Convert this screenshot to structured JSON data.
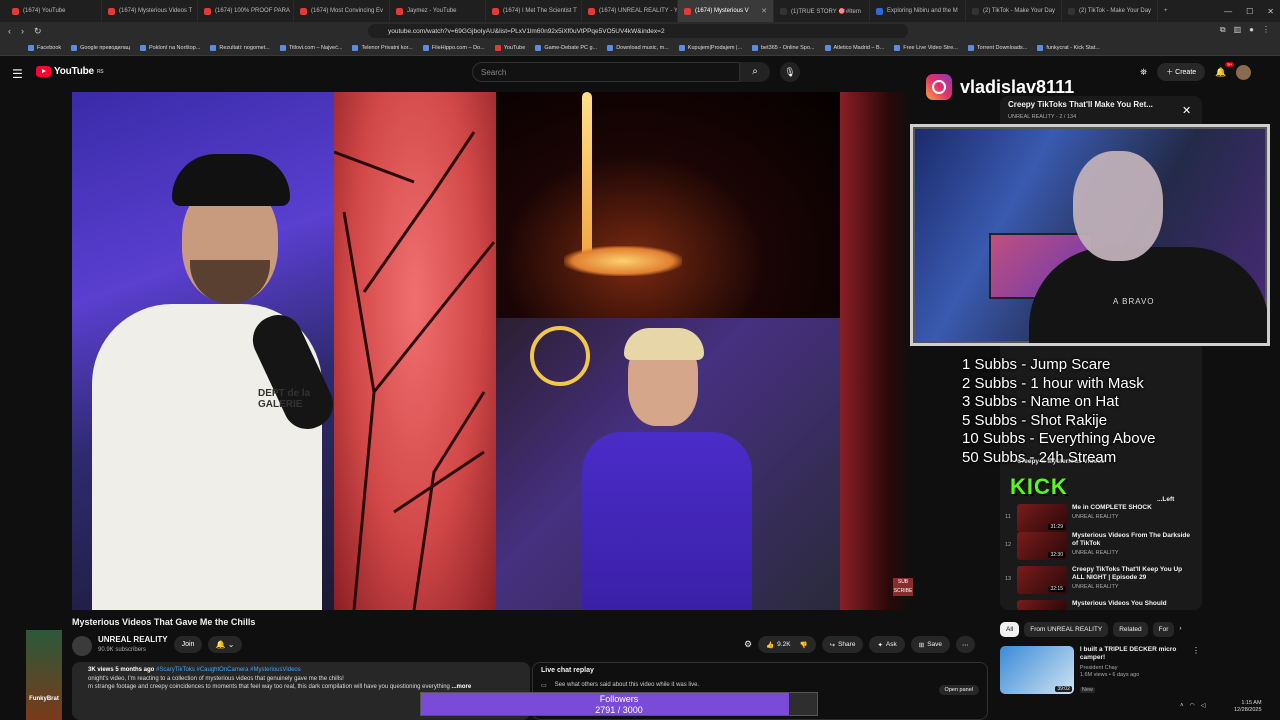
{
  "browser": {
    "tabs": [
      {
        "label": "(1674) YouTube",
        "active": false
      },
      {
        "label": "(1674) Mysterious Videos T",
        "active": false
      },
      {
        "label": "(1674) 100% PROOF PARA",
        "active": false
      },
      {
        "label": "(1674) Most Convincing Ev",
        "active": false
      },
      {
        "label": "Jaymez - YouTube",
        "active": false
      },
      {
        "label": "(1674) I Met The Scientist T",
        "active": false
      },
      {
        "label": "(1674) UNREAL REALITY - Y",
        "active": false
      },
      {
        "label": "(1674) Mysterious V",
        "active": true
      },
      {
        "label": "(1)TRUE STORY 🎯#Item",
        "active": false
      },
      {
        "label": "Exploring Nibiru and the M",
        "active": false
      },
      {
        "label": "(2) TikTok - Make Your Day",
        "active": false
      },
      {
        "label": "(2) TikTok - Make Your Day",
        "active": false
      }
    ],
    "url": "youtube.com/watch?v=69GGjboIyAU&list=PLxV1lm60n92x5iXf0uVtPPqe5VO5UV4kW&index=2",
    "bookmarks": [
      "Facebook",
      "Google преводилац",
      "Poklonī na Norštop...",
      "Rezultati: nogomet...",
      "Titlovi.com – Najveć...",
      "Telenor Privatni kor...",
      "FileHippo.com – Do...",
      "YouTube",
      "Game-Debate PC g...",
      "Download music, m...",
      "Kupujem|Prodajem |...",
      "bet365 - Online Spo...",
      "Atletico Madrid – B...",
      "Free Live Video Stre...",
      "Torrent Downloads...",
      "funkycrat - Kick Stat..."
    ]
  },
  "youtube": {
    "logo": "YouTube",
    "logo_region": "RS",
    "search_placeholder": "Search",
    "create_label": "Create",
    "notif_count": "9+"
  },
  "video": {
    "title": "Mysterious Videos That Gave Me the Chills",
    "man_shirt_text": "DEPT de la GALERIE",
    "watermark": "SUB SCRIBE"
  },
  "channel": {
    "name": "UNREAL REALITY",
    "subs": "90.9K subscribers",
    "join": "Join"
  },
  "actions": {
    "likes": "9.2K",
    "share": "Share",
    "ask": "Ask",
    "save": "Save"
  },
  "description": {
    "stats": "3K views  5 months ago",
    "tags": "#ScaryTikToks #CaughtOnCamera #MysteriousVideos",
    "line1": "onight's video, I'm reacting to a collection of mysterious videos that genuinely gave me the chills!",
    "line2": "m strange footage and creepy coincidences to moments that feel way too real, this dark compilation will have you questioning everything",
    "more": "...more"
  },
  "live_chat": {
    "title": "Live chat replay",
    "note": "See what others said about this video while it was live.",
    "open": "Open panel"
  },
  "followers": {
    "label": "Followers",
    "count": "2791 / 3000",
    "progress": 0.93
  },
  "playlist": {
    "title": "Creepy TikToks That'll Make You Ret...",
    "sub": "UNREAL REALITY - 2 / 134",
    "items": [
      {
        "idx": "",
        "title": "Creepy & Mysterious Videos",
        "channel": "",
        "dur": ""
      },
      {
        "idx": "",
        "title": "...Left",
        "channel": "",
        "dur": ""
      },
      {
        "idx": "11",
        "title": "Me in COMPLETE SHOCK",
        "channel": "UNREAL REALITY",
        "dur": "31:29"
      },
      {
        "idx": "12",
        "title": "Mysterious Videos From The Darkside of TikTok",
        "channel": "UNREAL REALITY",
        "dur": "32:30"
      },
      {
        "idx": "13",
        "title": "Creepy TikToks That'll Keep You Up ALL NIGHT | Episode 29",
        "channel": "UNREAL REALITY",
        "dur": "32:15"
      },
      {
        "idx": "14",
        "title": "Mysterious Videos You Should",
        "channel": "",
        "dur": ""
      }
    ]
  },
  "chips": [
    "All",
    "From UNREAL REALITY",
    "Related",
    "For"
  ],
  "recommendation": {
    "title": "I built a TRIPLE DECKER micro camper!",
    "channel": "President Chay",
    "meta": "1.6M views • 6 days ago",
    "badge": "New",
    "dur": "39:02"
  },
  "overlay": {
    "instagram": "vladislav8111",
    "shirt_text": "A BRAVO",
    "kick": "KICK",
    "sub_goals": [
      "1 Subbs - Jump Scare",
      "2 Subbs - 1 hour with Mask",
      "3 Subbs - Name on Hat",
      "5 Subbs - Shot Rakije",
      "10 Subbs - Everything Above",
      "50 Subbs - 24h Stream"
    ],
    "streamer_logo": "FunkyBrat"
  },
  "system": {
    "time": "1:15 AM",
    "date": "12/28/2025"
  }
}
